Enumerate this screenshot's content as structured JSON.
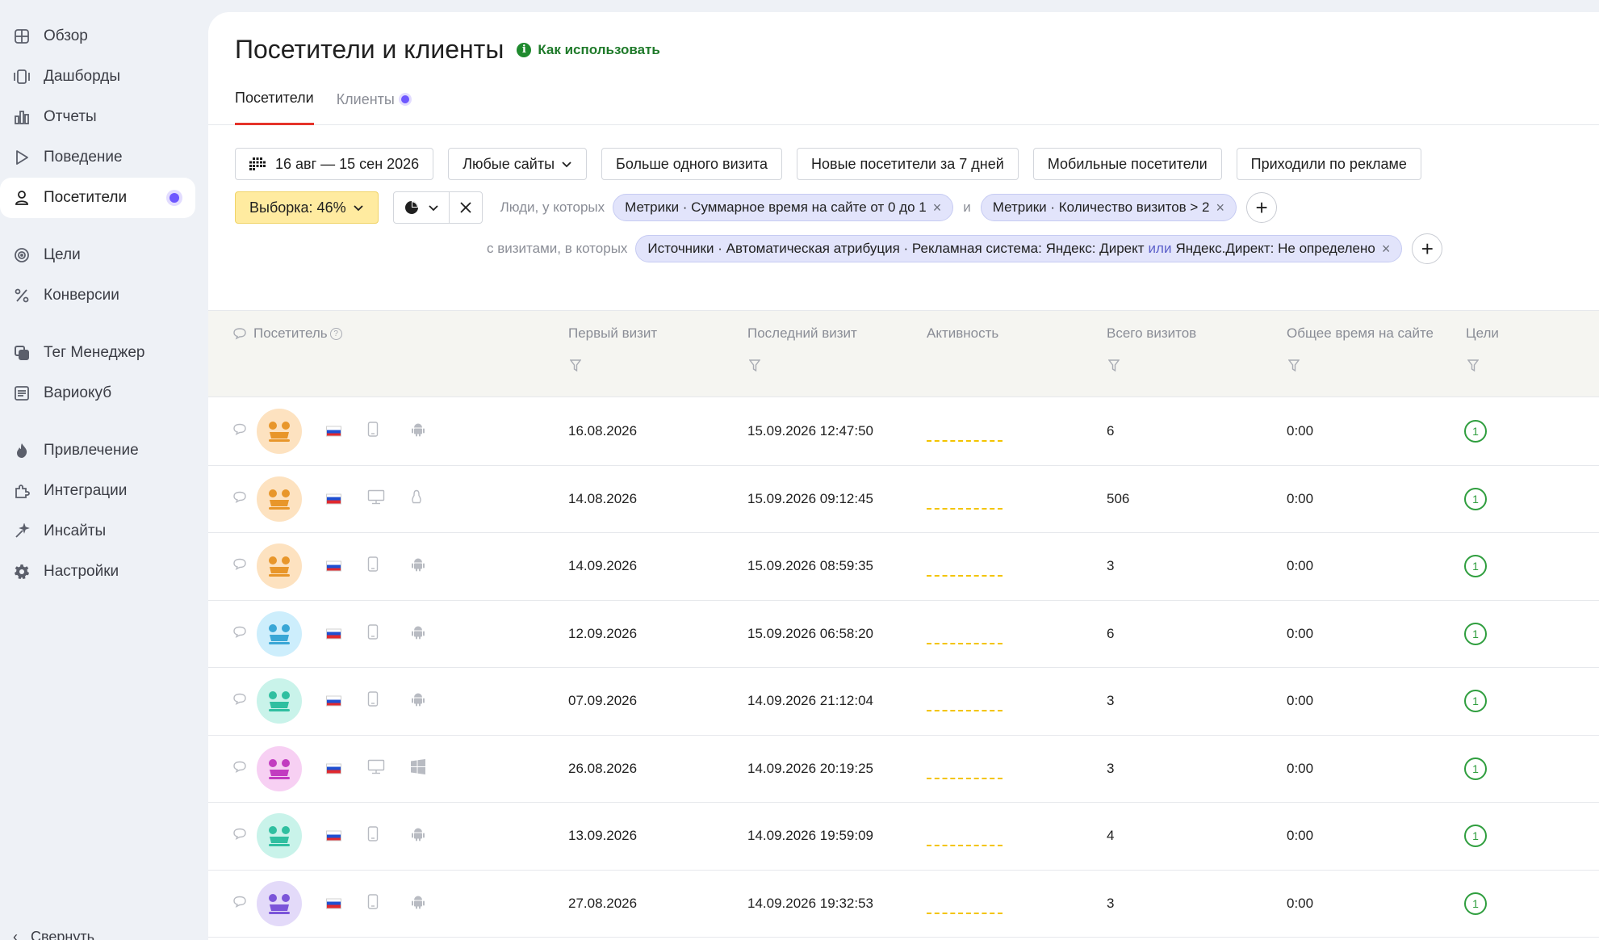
{
  "sidebar": {
    "items": [
      {
        "label": "Обзор",
        "icon": "grid-icon"
      },
      {
        "label": "Дашборды",
        "icon": "dashboards-icon"
      },
      {
        "label": "Отчеты",
        "icon": "bar-chart-icon"
      },
      {
        "label": "Поведение",
        "icon": "play-icon"
      },
      {
        "label": "Посетители",
        "icon": "person-icon",
        "active": true
      },
      {
        "label": "Цели",
        "icon": "target-icon"
      },
      {
        "label": "Конверсии",
        "icon": "percent-icon"
      },
      {
        "label": "Тег Менеджер",
        "icon": "tag-manager-icon"
      },
      {
        "label": "Вариокуб",
        "icon": "variocube-icon"
      },
      {
        "label": "Привлечение",
        "icon": "flame-icon"
      },
      {
        "label": "Интеграции",
        "icon": "puzzle-icon"
      },
      {
        "label": "Инсайты",
        "icon": "sparkle-icon"
      },
      {
        "label": "Настройки",
        "icon": "gear-icon"
      }
    ],
    "collapse_label": "Свернуть"
  },
  "header": {
    "title": "Посетители и клиенты",
    "howto_label": "Как использовать",
    "tabs": [
      {
        "label": "Посетители",
        "active": true
      },
      {
        "label": "Клиенты",
        "active": false
      }
    ]
  },
  "filters": {
    "date_range": "16 авг — 15 сен 2026",
    "sites": "Любые сайты",
    "presets": [
      "Больше одного визита",
      "Новые посетители за 7 дней",
      "Мобильные посетители",
      "Приходили по рекламе"
    ],
    "sample": "Выборка: 46%",
    "people_label": "Люди, у которых",
    "conditions": [
      "Метрики · Суммарное время на сайте от 0 до 1",
      "Метрики · Количество визитов > 2"
    ],
    "and_word": "и",
    "visits_label": "с визитами, в которых",
    "visit_condition": {
      "part1": "Источники · Автоматическая атрибуция · Рекламная система: Яндекс: Директ",
      "or_word": "или",
      "part2": "Яндекс.Директ: Не определено"
    }
  },
  "table": {
    "columns": {
      "visitor": "Посетитель",
      "first_visit": "Первый визит",
      "last_visit": "Последний визит",
      "activity": "Активность",
      "total_visits": "Всего визитов",
      "total_time": "Общее время на сайте",
      "goals": "Цели"
    },
    "rows": [
      {
        "avatar_color": "#fde2c0",
        "avatar_fg": "#e8962a",
        "device": "mobile",
        "os": "android",
        "first_visit": "16.08.2026",
        "last_visit": "15.09.2026 12:47:50",
        "visits": "6",
        "time": "0:00",
        "goals": "1"
      },
      {
        "avatar_color": "#fde2c0",
        "avatar_fg": "#e8962a",
        "device": "desktop",
        "os": "linux",
        "first_visit": "14.08.2026",
        "last_visit": "15.09.2026 09:12:45",
        "visits": "506",
        "time": "0:00",
        "goals": "1"
      },
      {
        "avatar_color": "#fde2c0",
        "avatar_fg": "#e8962a",
        "device": "mobile",
        "os": "android",
        "first_visit": "14.09.2026",
        "last_visit": "15.09.2026 08:59:35",
        "visits": "3",
        "time": "0:00",
        "goals": "1"
      },
      {
        "avatar_color": "#cdeefc",
        "avatar_fg": "#3aa7d6",
        "device": "mobile",
        "os": "android",
        "first_visit": "12.09.2026",
        "last_visit": "15.09.2026 06:58:20",
        "visits": "6",
        "time": "0:00",
        "goals": "1"
      },
      {
        "avatar_color": "#c9f3ea",
        "avatar_fg": "#2fbfa0",
        "device": "mobile",
        "os": "android",
        "first_visit": "07.09.2026",
        "last_visit": "14.09.2026 21:12:04",
        "visits": "3",
        "time": "0:00",
        "goals": "1"
      },
      {
        "avatar_color": "#f7d0f3",
        "avatar_fg": "#c23cc0",
        "device": "desktop",
        "os": "windows",
        "first_visit": "26.08.2026",
        "last_visit": "14.09.2026 20:19:25",
        "visits": "3",
        "time": "0:00",
        "goals": "1"
      },
      {
        "avatar_color": "#c9f3ea",
        "avatar_fg": "#2fbfa0",
        "device": "mobile",
        "os": "android",
        "first_visit": "13.09.2026",
        "last_visit": "14.09.2026 19:59:09",
        "visits": "4",
        "time": "0:00",
        "goals": "1"
      },
      {
        "avatar_color": "#e3daf9",
        "avatar_fg": "#7b55d9",
        "device": "mobile",
        "os": "android",
        "first_visit": "27.08.2026",
        "last_visit": "14.09.2026 19:32:53",
        "visits": "3",
        "time": "0:00",
        "goals": "1"
      }
    ]
  }
}
